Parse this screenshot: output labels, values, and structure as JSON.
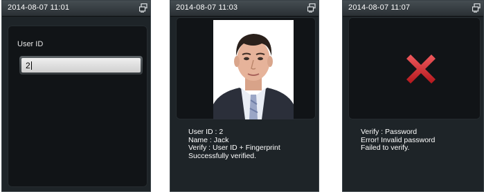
{
  "screens": {
    "user_id_entry": {
      "clock": "2014-08-07 11:01",
      "status_icon": "network-icon",
      "field_label": "User ID",
      "field_value": "2"
    },
    "verify_success": {
      "clock": "2014-08-07 11:03",
      "status_icon": "network-icon",
      "photo": "user-photo",
      "lines": [
        "User ID : 2",
        "Name : Jack",
        "Verify : User ID + Fingerprint",
        "Successfully verified."
      ]
    },
    "verify_failed": {
      "clock": "2014-08-07 11:07",
      "status_icon": "network-icon",
      "result_icon": "error-x-icon",
      "lines": [
        "Verify : Password",
        "Error! Invalid password",
        "Failed to verify."
      ]
    }
  },
  "colors": {
    "device_bg": "#1e2428",
    "panel_bg": "#111417",
    "text": "#ffffff",
    "error_red": "#d0262b"
  }
}
